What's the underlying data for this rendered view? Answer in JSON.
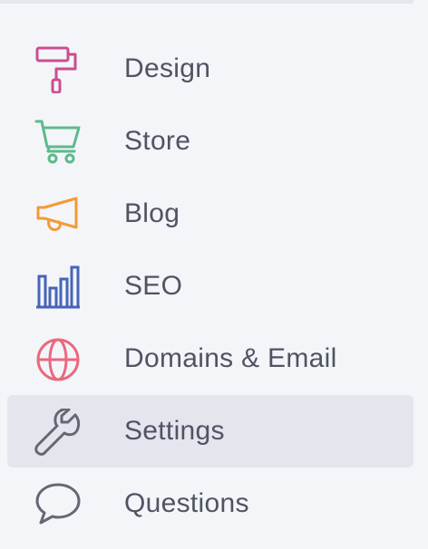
{
  "nav": {
    "items": [
      {
        "label": "Design",
        "icon": "paint-roller-icon",
        "color": "#c94e91",
        "active": false
      },
      {
        "label": "Store",
        "icon": "shopping-cart-icon",
        "color": "#5dba8c",
        "active": false
      },
      {
        "label": "Blog",
        "icon": "megaphone-icon",
        "color": "#f29b35",
        "active": false
      },
      {
        "label": "SEO",
        "icon": "bar-chart-icon",
        "color": "#4664b8",
        "active": false
      },
      {
        "label": "Domains & Email",
        "icon": "globe-icon",
        "color": "#e8697d",
        "active": false
      },
      {
        "label": "Settings",
        "icon": "wrench-icon",
        "color": "#646874",
        "active": true
      },
      {
        "label": "Questions",
        "icon": "speech-bubble-icon",
        "color": "#646874",
        "active": false
      }
    ]
  }
}
